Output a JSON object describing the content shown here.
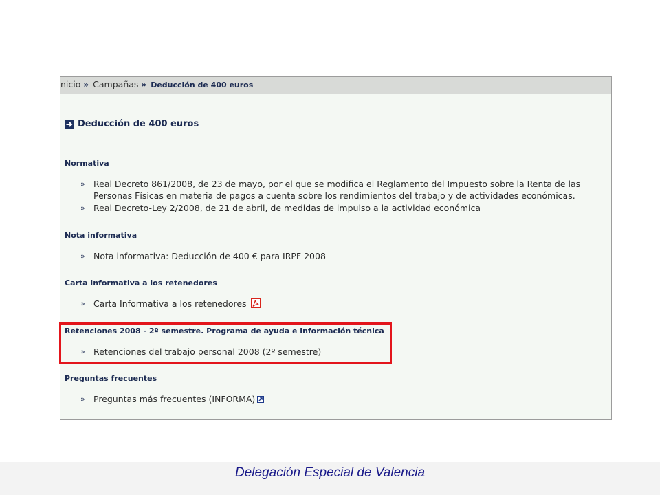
{
  "breadcrumb": {
    "links": [
      "nicio",
      "Campañas"
    ],
    "separator": "»",
    "current": "Deducción de 400 euros"
  },
  "page_title": "Deducción de 400 euros",
  "list_bullet": "»",
  "sections": [
    {
      "heading": "Normativa",
      "items": [
        {
          "text": "Real Decreto 861/2008, de 23 de mayo, por el que se modifica el Reglamento del Impuesto sobre la Renta de las Personas Físicas en materia de pagos a cuenta sobre los rendimientos del trabajo y de actividades económicas."
        },
        {
          "text": "Real Decreto-Ley 2/2008, de 21 de abril, de medidas de impulso a la actividad económica"
        }
      ]
    },
    {
      "heading": "Nota informativa",
      "items": [
        {
          "text": "Nota informativa: Deducción de 400 € para IRPF 2008"
        }
      ]
    },
    {
      "heading": "Carta informativa a los retenedores",
      "items": [
        {
          "text": "Carta Informativa a los retenedores",
          "icon": "pdf-icon"
        }
      ]
    },
    {
      "heading": "Retenciones 2008 - 2º semestre. Programa de ayuda e información técnica",
      "highlighted": true,
      "items": [
        {
          "text": "Retenciones del trabajo personal 2008 (2º semestre)"
        }
      ]
    },
    {
      "heading": "Preguntas frecuentes",
      "items": [
        {
          "text": "Preguntas más frecuentes (INFORMA)",
          "icon": "external-link-icon"
        }
      ]
    }
  ],
  "footer": {
    "text": "Delegación Especial de Valencia"
  },
  "icons": {
    "title": "arrow-right-icon",
    "pdf": "pdf-icon",
    "external_link": "external-link-icon"
  },
  "colors": {
    "heading": "#1c2b52",
    "text": "#2b2b2b",
    "highlight_border": "#e3151b",
    "footer_text": "#1a1a8a",
    "breadcrumb_bg": "#d8dad7",
    "content_bg": "#f4f8f3"
  }
}
